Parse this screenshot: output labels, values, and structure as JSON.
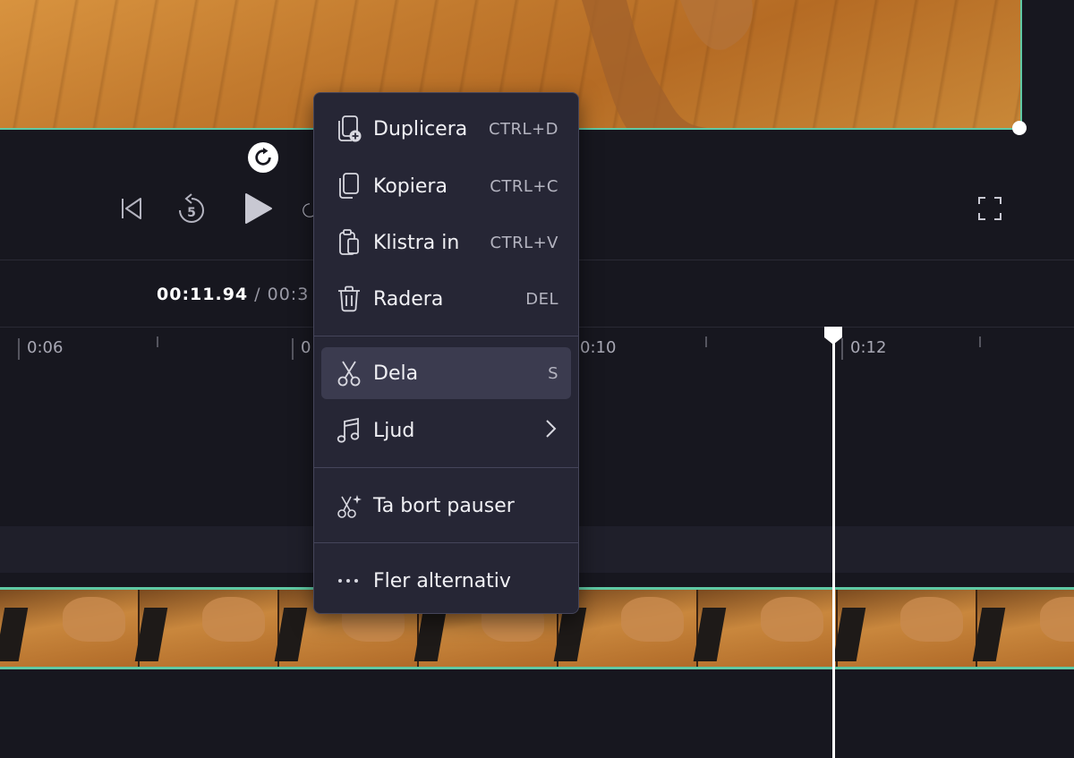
{
  "player": {
    "current_time": "00:11.94",
    "total_time": " / 00:3"
  },
  "timeline": {
    "ruler_labels": [
      "0:06",
      "0",
      "0:10",
      "0:12"
    ]
  },
  "context_menu": {
    "items": [
      {
        "label": "Duplicera",
        "shortcut": "CTRL+D",
        "icon": "duplicate-icon"
      },
      {
        "label": "Kopiera",
        "shortcut": "CTRL+C",
        "icon": "copy-icon"
      },
      {
        "label": "Klistra in",
        "shortcut": "CTRL+V",
        "icon": "paste-icon"
      },
      {
        "label": "Radera",
        "shortcut": "DEL",
        "icon": "trash-icon"
      },
      {
        "label": "Dela",
        "shortcut": "S",
        "icon": "scissors-icon"
      },
      {
        "label": "Ljud",
        "shortcut": "",
        "icon": "music-note-icon"
      },
      {
        "label": "Ta bort pauser",
        "shortcut": "",
        "icon": "sparkle-scissors-icon"
      },
      {
        "label": "Fler alternativ",
        "shortcut": "",
        "icon": "more-dots-icon"
      }
    ]
  },
  "colors": {
    "accent": "#5fc9a4",
    "background": "#17171f",
    "menu_bg": "#262635",
    "menu_active": "#3b3b4f"
  }
}
